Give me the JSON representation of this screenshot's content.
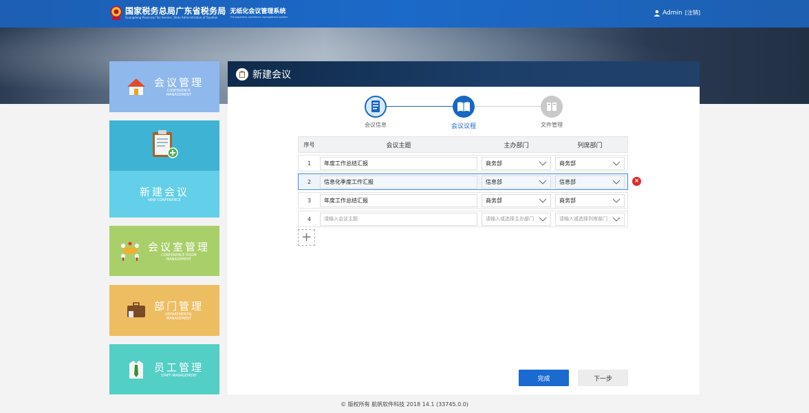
{
  "header": {
    "org_title": "国家税务总局广东省税务局",
    "org_sub": "Guangdong Provincial Tax Service, State Administration of Taxation",
    "system_title": "无纸化会议管理系统",
    "system_sub": "The paperless conference management system",
    "user_name": "Admin",
    "logout_label": "[注销]"
  },
  "sidebar": {
    "items": [
      {
        "cn": "会议管理",
        "en": "CONFERENCE MANAGEMENT"
      },
      {
        "cn": "新建会议",
        "en": "NEW CONFERENCE"
      },
      {
        "cn": "会议室管理",
        "en": "CONFERENCE ROOM MANAGEMENT"
      },
      {
        "cn": "部门管理",
        "en": "DEPARTMENTAL MANAGEMENT"
      },
      {
        "cn": "员工管理",
        "en": "STAFF MANAGEMENT"
      }
    ]
  },
  "panel": {
    "title": "新建会议"
  },
  "steps": [
    {
      "label": "会议信息"
    },
    {
      "label": "会议议程"
    },
    {
      "label": "文件管理"
    }
  ],
  "table": {
    "headers": {
      "no": "序号",
      "topic": "会议主题",
      "host": "主办部门",
      "attend": "列席部门"
    },
    "rows": [
      {
        "no": "1",
        "topic": "年度工作总结汇报",
        "host": "商务部",
        "attend": "商务部"
      },
      {
        "no": "2",
        "topic": "信息化季度工作汇报",
        "host": "信息部",
        "attend": "信息部"
      },
      {
        "no": "3",
        "topic": "年度工作总结汇报",
        "host": "商务部",
        "attend": "商务部"
      },
      {
        "no": "4",
        "topic_placeholder": "请输入会议主题",
        "host_placeholder": "请输入或选择主办部门",
        "attend_placeholder": "请输入或选择列席部门"
      }
    ]
  },
  "actions": {
    "finish": "完成",
    "next": "下一步"
  },
  "footer": {
    "text": "© 版权所有 航帆软件科技 2018   14.1 (33745.0.0)"
  },
  "colors": {
    "accent": "#1a6ad0",
    "delete": "#e02828"
  }
}
